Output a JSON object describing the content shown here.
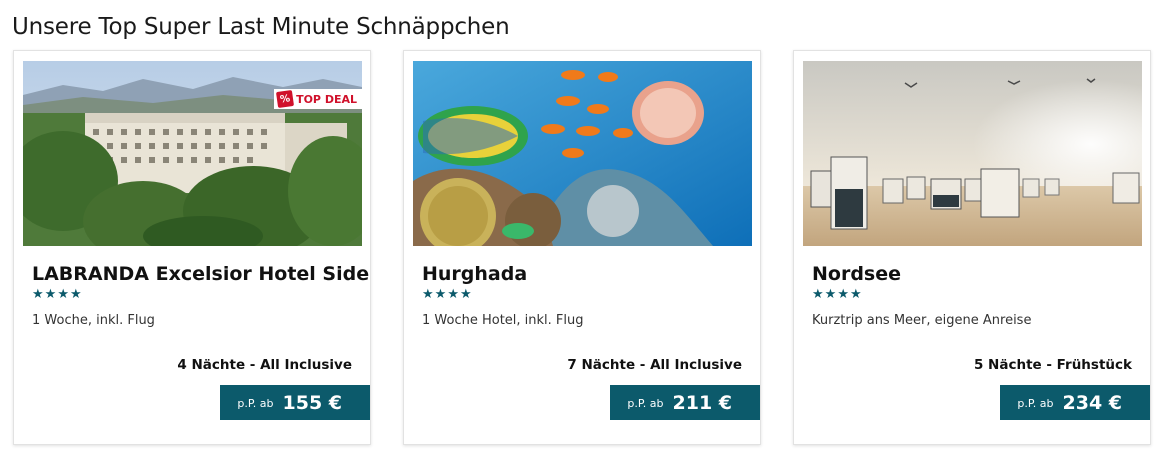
{
  "section": {
    "title": "Unsere Top Super Last Minute Schnäppchen"
  },
  "colors": {
    "accent": "#0c5a6b",
    "badge": "#d0112b"
  },
  "cards": [
    {
      "title": "LABRANDA Excelsior Hotel Side",
      "stars": 4,
      "description": "1 Woche, inkl. Flug",
      "nights": "4 Nächte - All Inclusive",
      "price_prefix": "p.P. ab",
      "price": "155 €",
      "badge": "TOP DEAL",
      "image": "hotel-resort-photo"
    },
    {
      "title": "Hurghada",
      "stars": 4,
      "description": "1 Woche Hotel, inkl. Flug",
      "nights": "7 Nächte - All Inclusive",
      "price_prefix": "p.P. ab",
      "price": "211 €",
      "image": "coral-reef-fish-photo"
    },
    {
      "title": "Nordsee",
      "stars": 4,
      "description": "Kurztrip ans Meer, eigene Anreise",
      "nights": "5 Nächte - Frühstück",
      "price_prefix": "p.P. ab",
      "price": "234 €",
      "image": "beach-chairs-photo"
    }
  ]
}
